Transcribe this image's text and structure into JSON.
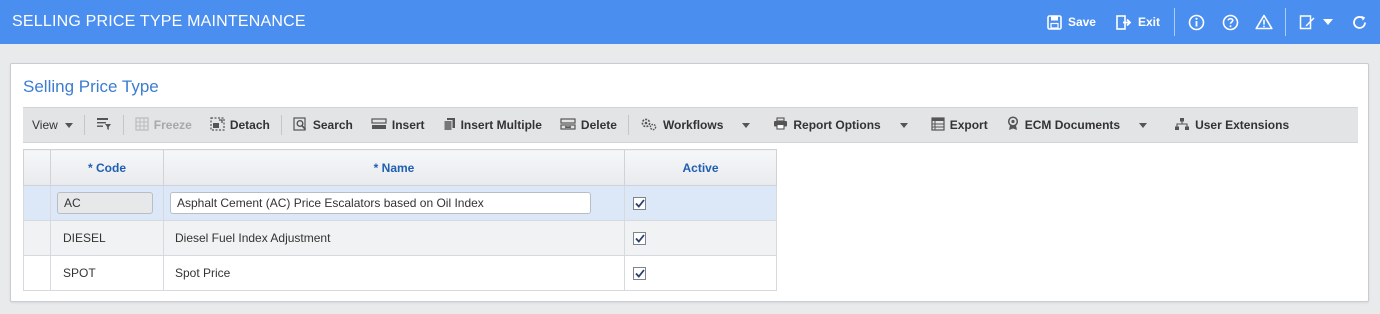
{
  "header": {
    "title": "SELLING PRICE TYPE MAINTENANCE",
    "save_label": "Save",
    "exit_label": "Exit"
  },
  "panel": {
    "title": "Selling Price Type"
  },
  "toolbar": {
    "view": "View",
    "freeze": "Freeze",
    "detach": "Detach",
    "search": "Search",
    "insert": "Insert",
    "insert_multiple": "Insert Multiple",
    "delete": "Delete",
    "workflows": "Workflows",
    "report_options": "Report Options",
    "export": "Export",
    "ecm_documents": "ECM Documents",
    "user_extensions": "User Extensions"
  },
  "grid": {
    "columns": {
      "code": "* Code",
      "name": "* Name",
      "active": "Active"
    },
    "rows": [
      {
        "code": "AC",
        "name": "Asphalt Cement (AC) Price Escalators based on Oil Index",
        "active": true
      },
      {
        "code": "DIESEL",
        "name": "Diesel Fuel Index Adjustment",
        "active": true
      },
      {
        "code": "SPOT",
        "name": "Spot Price",
        "active": true
      }
    ]
  },
  "colors": {
    "header_bg": "#4a8ef0",
    "panel_title": "#3a7dd1",
    "column_header_text": "#1f5fb2",
    "selected_row": "#dce8f8"
  }
}
